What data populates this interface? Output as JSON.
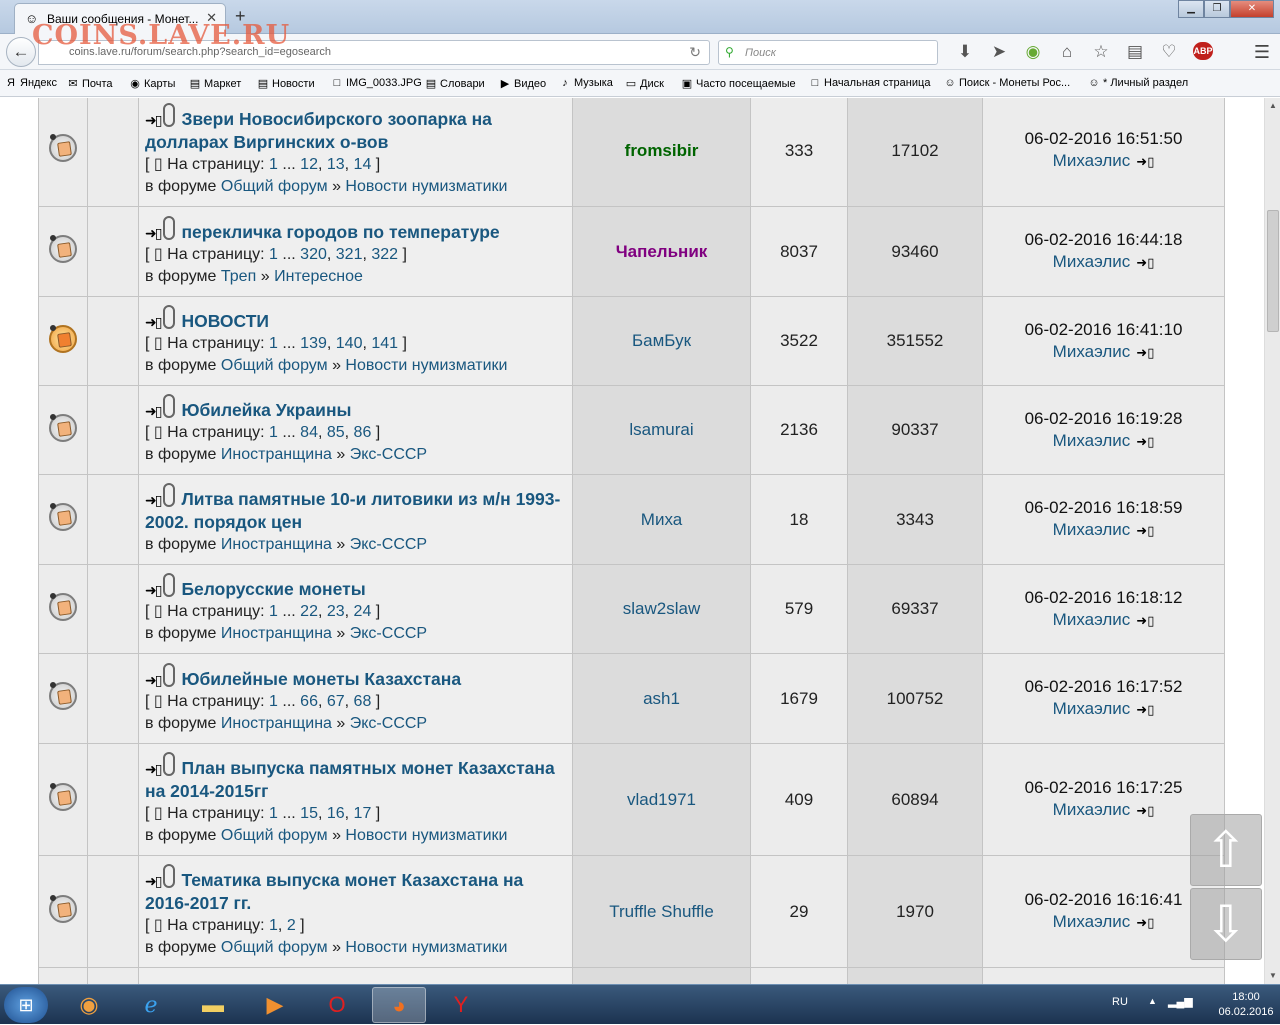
{
  "browser": {
    "tab_title": "Ваши сообщения - Монет...",
    "tab_close": "✕",
    "new_tab": "+",
    "url": "coins.lave.ru/forum/search.php?search_id=egosearch",
    "search_placeholder": "Поиск",
    "watermark": "COINS.LAVE.RU",
    "abp_label": "ABP",
    "bookmarks": [
      {
        "icon": "Я",
        "label": "Яндекс"
      },
      {
        "icon": "✉",
        "label": "Почта"
      },
      {
        "icon": "◉",
        "label": "Карты"
      },
      {
        "icon": "▤",
        "label": "Маркет"
      },
      {
        "icon": "▤",
        "label": "Новости"
      },
      {
        "icon": "□",
        "label": "IMG_0033.JPG"
      },
      {
        "icon": "▤",
        "label": "Словари"
      },
      {
        "icon": "▶",
        "label": "Видео"
      },
      {
        "icon": "♪",
        "label": "Музыка"
      },
      {
        "icon": "▭",
        "label": "Диск"
      },
      {
        "icon": "▣",
        "label": "Часто посещаемые"
      },
      {
        "icon": "□",
        "label": "Начальная страница"
      },
      {
        "icon": "☺",
        "label": "Поиск - Монеты Рос..."
      },
      {
        "icon": "☺",
        "label": "* Личный раздел"
      }
    ]
  },
  "labels": {
    "pages_prefix": "На страницу:",
    "forum_prefix": "в форуме",
    "sep": "»",
    "ellipsis": "..."
  },
  "topics": [
    {
      "title": "Звери Новосибирского зоопарка на долларах Виргинских о-вов",
      "pages": [
        "1",
        "12",
        "13",
        "14"
      ],
      "forum": "Общий форум",
      "subforum": "Новости нумизматики",
      "author": "fromsibir",
      "author_style": "green",
      "replies": "333",
      "views": "17102",
      "last_date": "06-02-2016 16:51:50",
      "last_user": "Михаэлис",
      "hot": false
    },
    {
      "title": "перекличка городов по температуре",
      "pages": [
        "1",
        "320",
        "321",
        "322"
      ],
      "forum": "Треп",
      "subforum": "Интересное",
      "author": "Чапельник",
      "author_style": "purple",
      "replies": "8037",
      "views": "93460",
      "last_date": "06-02-2016 16:44:18",
      "last_user": "Михаэлис",
      "hot": false
    },
    {
      "title": "НОВОСТИ",
      "pages": [
        "1",
        "139",
        "140",
        "141"
      ],
      "forum": "Общий форум",
      "subforum": "Новости нумизматики",
      "author": "БамБук",
      "author_style": "",
      "replies": "3522",
      "views": "351552",
      "last_date": "06-02-2016 16:41:10",
      "last_user": "Михаэлис",
      "hot": true
    },
    {
      "title": "Юбилейка Украины",
      "pages": [
        "1",
        "84",
        "85",
        "86"
      ],
      "forum": "Иностранщина",
      "subforum": "Экс-СССР",
      "author": "lsamurai",
      "author_style": "",
      "replies": "2136",
      "views": "90337",
      "last_date": "06-02-2016 16:19:28",
      "last_user": "Михаэлис",
      "hot": false
    },
    {
      "title": "Литва памятные 10-и литовики из м/н 1993-2002. порядок цен",
      "pages": [],
      "forum": "Иностранщина",
      "subforum": "Экс-СССР",
      "author": "Миха",
      "author_style": "",
      "replies": "18",
      "views": "3343",
      "last_date": "06-02-2016 16:18:59",
      "last_user": "Михаэлис",
      "hot": false
    },
    {
      "title": "Белорусские монеты",
      "pages": [
        "1",
        "22",
        "23",
        "24"
      ],
      "forum": "Иностранщина",
      "subforum": "Экс-СССР",
      "author": "slaw2slaw",
      "author_style": "",
      "replies": "579",
      "views": "69337",
      "last_date": "06-02-2016 16:18:12",
      "last_user": "Михаэлис",
      "hot": false
    },
    {
      "title": "Юбилейные монеты Казахстана",
      "pages": [
        "1",
        "66",
        "67",
        "68"
      ],
      "forum": "Иностранщина",
      "subforum": "Экс-СССР",
      "author": "ash1",
      "author_style": "",
      "replies": "1679",
      "views": "100752",
      "last_date": "06-02-2016 16:17:52",
      "last_user": "Михаэлис",
      "hot": false
    },
    {
      "title": "План выпуска памятных монет Казахстана на 2014-2015гг",
      "pages": [
        "1",
        "15",
        "16",
        "17"
      ],
      "forum": "Общий форум",
      "subforum": "Новости нумизматики",
      "author": "vlad1971",
      "author_style": "",
      "replies": "409",
      "views": "60894",
      "last_date": "06-02-2016 16:17:25",
      "last_user": "Михаэлис",
      "hot": false
    },
    {
      "title": "Тематика выпуска монет Казахстана на 2016-2017 гг.",
      "pages": [
        "1",
        "2"
      ],
      "forum": "Общий форум",
      "subforum": "Новости нумизматики",
      "author": "Truffle Shuffle",
      "author_style": "",
      "replies": "29",
      "views": "1970",
      "last_date": "06-02-2016 16:16:41",
      "last_user": "Михаэлис",
      "hot": false
    }
  ],
  "taskbar": {
    "lang": "RU",
    "time": "18:00",
    "date": "06.02.2016"
  }
}
